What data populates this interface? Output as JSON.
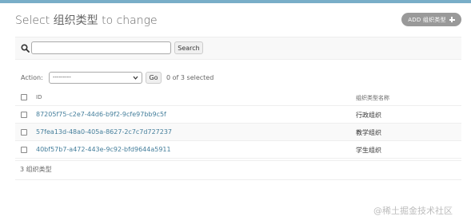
{
  "header": {
    "title": "Select 组织类型 to change",
    "add_button_label": "ADD 组织类型"
  },
  "search": {
    "value": "",
    "placeholder": "",
    "button_label": "Search"
  },
  "actions": {
    "label": "Action:",
    "selected_option": "---------",
    "go_label": "Go",
    "selected_count": "0 of 3 selected"
  },
  "table": {
    "columns": [
      "ID",
      "组织类型名称"
    ],
    "rows": [
      {
        "id": "87205f75-c2e7-44d6-b9f2-9cfe97bb9c5f",
        "name": "行政组织"
      },
      {
        "id": "57fea13d-48a0-405a-8627-2c7c7d727237",
        "name": "教学组织"
      },
      {
        "id": "40bf57b7-a472-443e-9c92-bfd9644a5911",
        "name": "学生组织"
      }
    ]
  },
  "paginator": {
    "text": "3 组织类型"
  },
  "watermark": {
    "text": "@稀土掘金技术社区"
  },
  "colors": {
    "accent": "#79aec8",
    "link": "#447e9b",
    "add_button": "#999999"
  },
  "icons": [
    "search-icon",
    "plus-icon",
    "chevron-down-icon"
  ]
}
